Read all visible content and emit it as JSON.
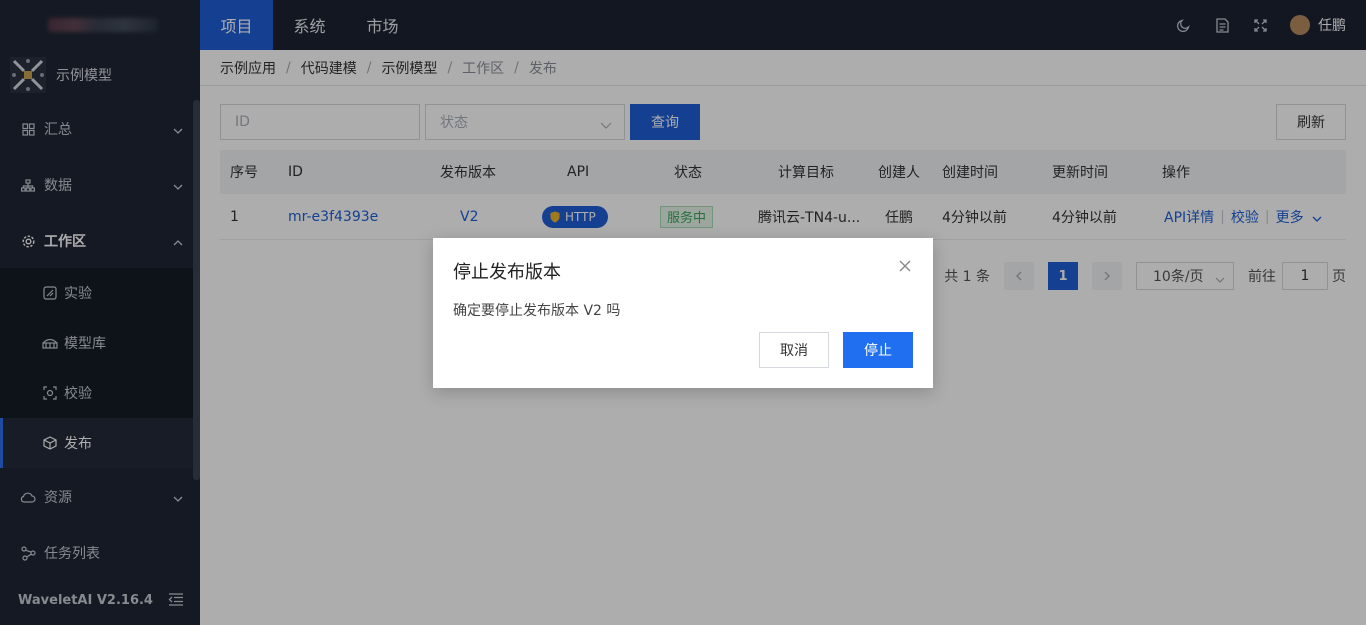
{
  "sidebar": {
    "project_label": "示例模型",
    "items": [
      {
        "label": "汇总",
        "icon": "grid-icon"
      },
      {
        "label": "数据",
        "icon": "hierarchy-icon"
      },
      {
        "label": "工作区",
        "icon": "gear-icon"
      },
      {
        "label": "资源",
        "icon": "cloud-icon"
      },
      {
        "label": "任务列表",
        "icon": "network-icon"
      }
    ],
    "subitems": [
      {
        "label": "实验",
        "icon": "experiment-icon"
      },
      {
        "label": "模型库",
        "icon": "model-library-icon"
      },
      {
        "label": "校验",
        "icon": "scan-icon"
      },
      {
        "label": "发布",
        "icon": "cube-icon"
      }
    ],
    "version": "WaveletAI V2.16.4"
  },
  "topbar": {
    "tabs": [
      "项目",
      "系统",
      "市场"
    ],
    "active_tab": "项目",
    "user_name": "任鹏"
  },
  "breadcrumb": [
    "示例应用",
    "代码建模",
    "示例模型",
    "工作区",
    "发布"
  ],
  "filter": {
    "id_placeholder": "ID",
    "status_placeholder": "状态",
    "search_label": "查询",
    "refresh_label": "刷新"
  },
  "table": {
    "headers": [
      "序号",
      "ID",
      "发布版本",
      "API",
      "状态",
      "计算目标",
      "创建人",
      "创建时间",
      "更新时间",
      "操作"
    ],
    "rows": [
      {
        "index": "1",
        "id": "mr-e3f4393e",
        "version": "V2",
        "api": "HTTP",
        "status": "服务中",
        "target": "腾讯云-TN4-u...",
        "creator": "任鹏",
        "created": "4分钟以前",
        "updated": "4分钟以前",
        "op_api": "API详情",
        "op_check": "校验",
        "op_more": "更多"
      }
    ]
  },
  "pager": {
    "total": "共 1 条",
    "current": "1",
    "page_size": "10条/页",
    "goto_label": "前往",
    "goto_value": "1",
    "page_suffix": "页"
  },
  "dialog": {
    "title": "停止发布版本",
    "message": "确定要停止发布版本 V2 吗",
    "cancel": "取消",
    "confirm": "停止"
  },
  "colors": {
    "primary": "#1f5fd6",
    "sidebar_bg": "#1f2634",
    "topbar_bg": "#1b2232",
    "status_green": "#3aa55a"
  }
}
